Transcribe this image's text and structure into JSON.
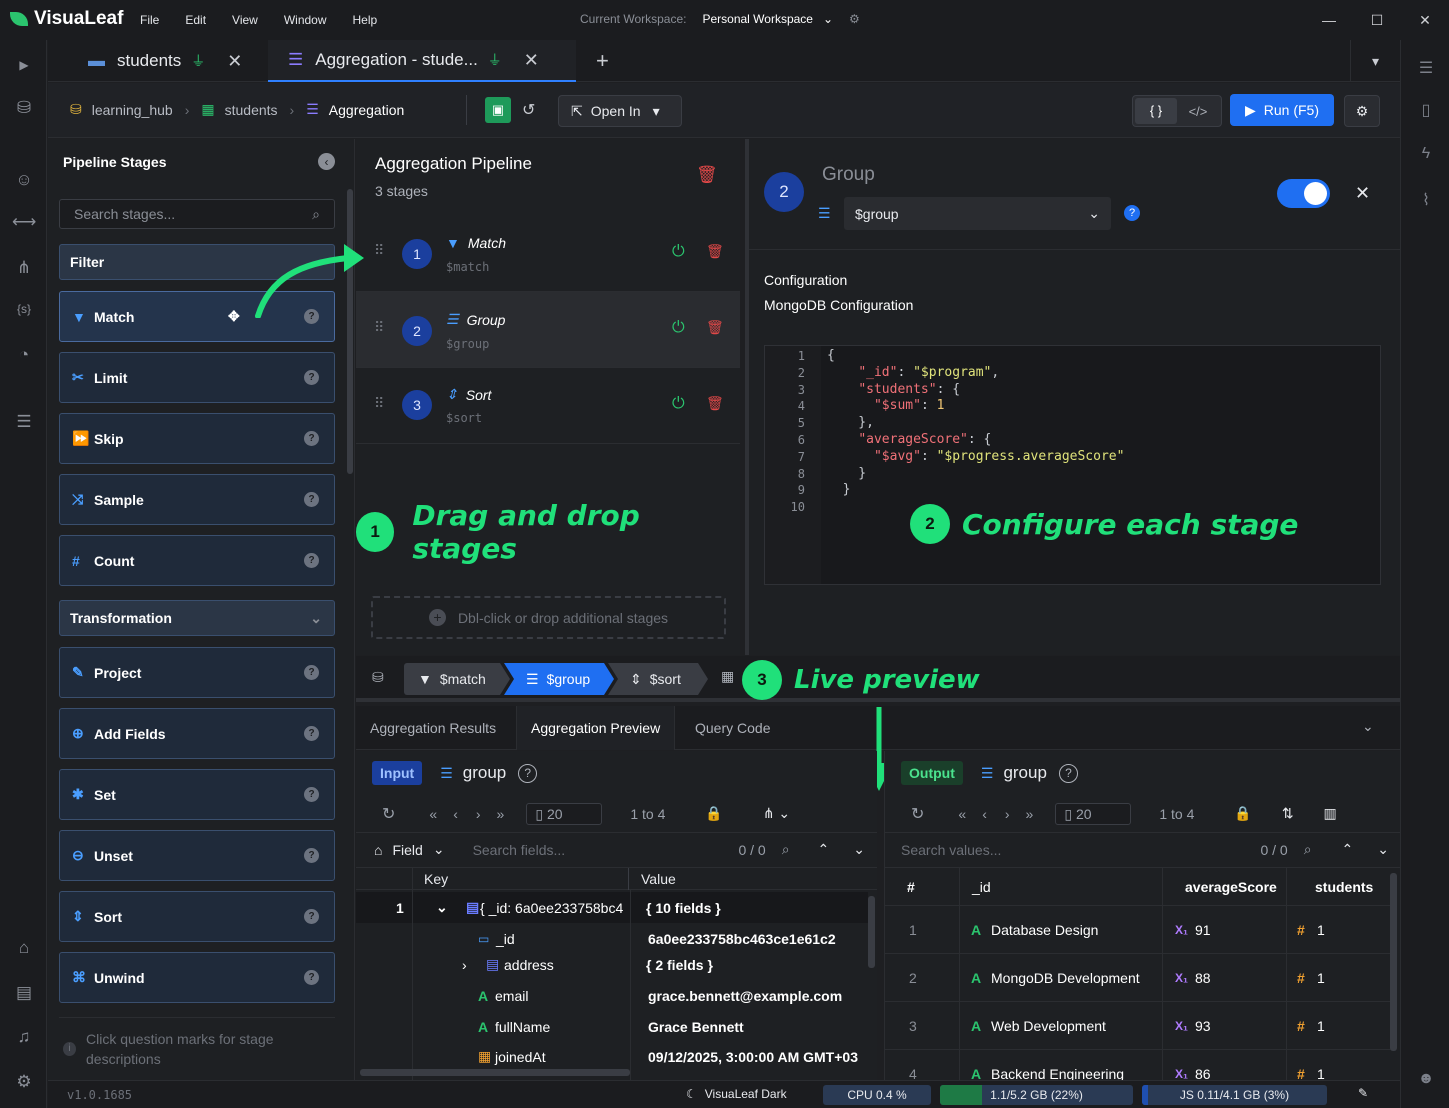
{
  "app": {
    "name": "VisuaLeaf",
    "menu": [
      "File",
      "Edit",
      "View",
      "Window",
      "Help"
    ],
    "workspace_label": "Current Workspace:",
    "workspace_value": "Personal Workspace"
  },
  "tabs": [
    {
      "label": "students"
    },
    {
      "label": "Aggregation - stude..."
    }
  ],
  "breadcrumb": {
    "db": "learning_hub",
    "collection": "students",
    "view": "Aggregation"
  },
  "toolbar": {
    "open_in": "Open In",
    "json_btn": "{ }",
    "code_btn": "</>",
    "run": "Run (F5)"
  },
  "stages_panel": {
    "title": "Pipeline Stages",
    "search_placeholder": "Search stages...",
    "filter_section": "Filter",
    "transform_section": "Transformation",
    "filter_items": [
      "Match",
      "Limit",
      "Skip",
      "Sample",
      "Count"
    ],
    "transform_items": [
      "Project",
      "Add Fields",
      "Set",
      "Unset",
      "Sort",
      "Unwind"
    ],
    "hint": "Click question marks for stage descriptions"
  },
  "pipeline": {
    "title": "Aggregation Pipeline",
    "count": "3 stages",
    "stages": [
      {
        "num": "1",
        "name": "Match",
        "op": "$match"
      },
      {
        "num": "2",
        "name": "Group",
        "op": "$group"
      },
      {
        "num": "3",
        "name": "Sort",
        "op": "$sort"
      }
    ],
    "drop_hint": "Dbl-click or drop additional stages"
  },
  "config": {
    "num": "2",
    "title": "Group",
    "op": "$group",
    "label1": "Configuration",
    "label2": "MongoDB Configuration",
    "lines": [
      "1",
      "2",
      "3",
      "4",
      "5",
      "6",
      "7",
      "8",
      "9",
      "10"
    ]
  },
  "callouts": {
    "c1_num": "1",
    "c1": "Drag and drop stages",
    "c2_num": "2",
    "c2": "Configure each stage",
    "c3_num": "3",
    "c3": "Live preview"
  },
  "stage_crumbs": [
    "$match",
    "$group",
    "$sort"
  ],
  "bottom_tabs": [
    "Aggregation Results",
    "Aggregation Preview",
    "Query Code"
  ],
  "input_panel": {
    "badge": "Input",
    "stage": "group",
    "page_size": "20",
    "range": "1 to 4",
    "field_label": "Field",
    "search_placeholder": "Search fields...",
    "match_count": "0 / 0",
    "col_key": "Key",
    "col_value": "Value",
    "rows": [
      {
        "num": "1",
        "key": "{ _id: 6a0ee233758bc4",
        "value": "{ 10 fields }"
      },
      {
        "num": "",
        "key": "_id",
        "value": "6a0ee233758bc463ce1e61c2"
      },
      {
        "num": "",
        "key": "address",
        "value": "{ 2 fields }"
      },
      {
        "num": "",
        "key": "email",
        "value": "grace.bennett@example.com"
      },
      {
        "num": "",
        "key": "fullName",
        "value": "Grace Bennett"
      },
      {
        "num": "",
        "key": "joinedAt",
        "value": "09/12/2025, 3:00:00 AM GMT+03"
      }
    ]
  },
  "output_panel": {
    "badge": "Output",
    "stage": "group",
    "page_size": "20",
    "range": "1 to 4",
    "search_placeholder": "Search values...",
    "match_count": "0 / 0",
    "columns": [
      "#",
      "_id",
      "averageScore",
      "students"
    ],
    "rows": [
      {
        "num": "1",
        "id": "Database Design",
        "avg": "91",
        "students": "1"
      },
      {
        "num": "2",
        "id": "MongoDB Development",
        "avg": "88",
        "students": "1"
      },
      {
        "num": "3",
        "id": "Web Development",
        "avg": "93",
        "students": "1"
      },
      {
        "num": "4",
        "id": "Backend Engineering",
        "avg": "86",
        "students": "1"
      }
    ]
  },
  "status": {
    "version": "v1.0.1685",
    "theme": "VisuaLeaf Dark",
    "cpu": "CPU 0.4 %",
    "mem": "1.1/5.2 GB (22%)",
    "js": "JS 0.11/4.1 GB (3%)"
  },
  "colors": {
    "accent": "#1f6ff2",
    "green": "#20e07a",
    "brand": "#2bc46e"
  }
}
